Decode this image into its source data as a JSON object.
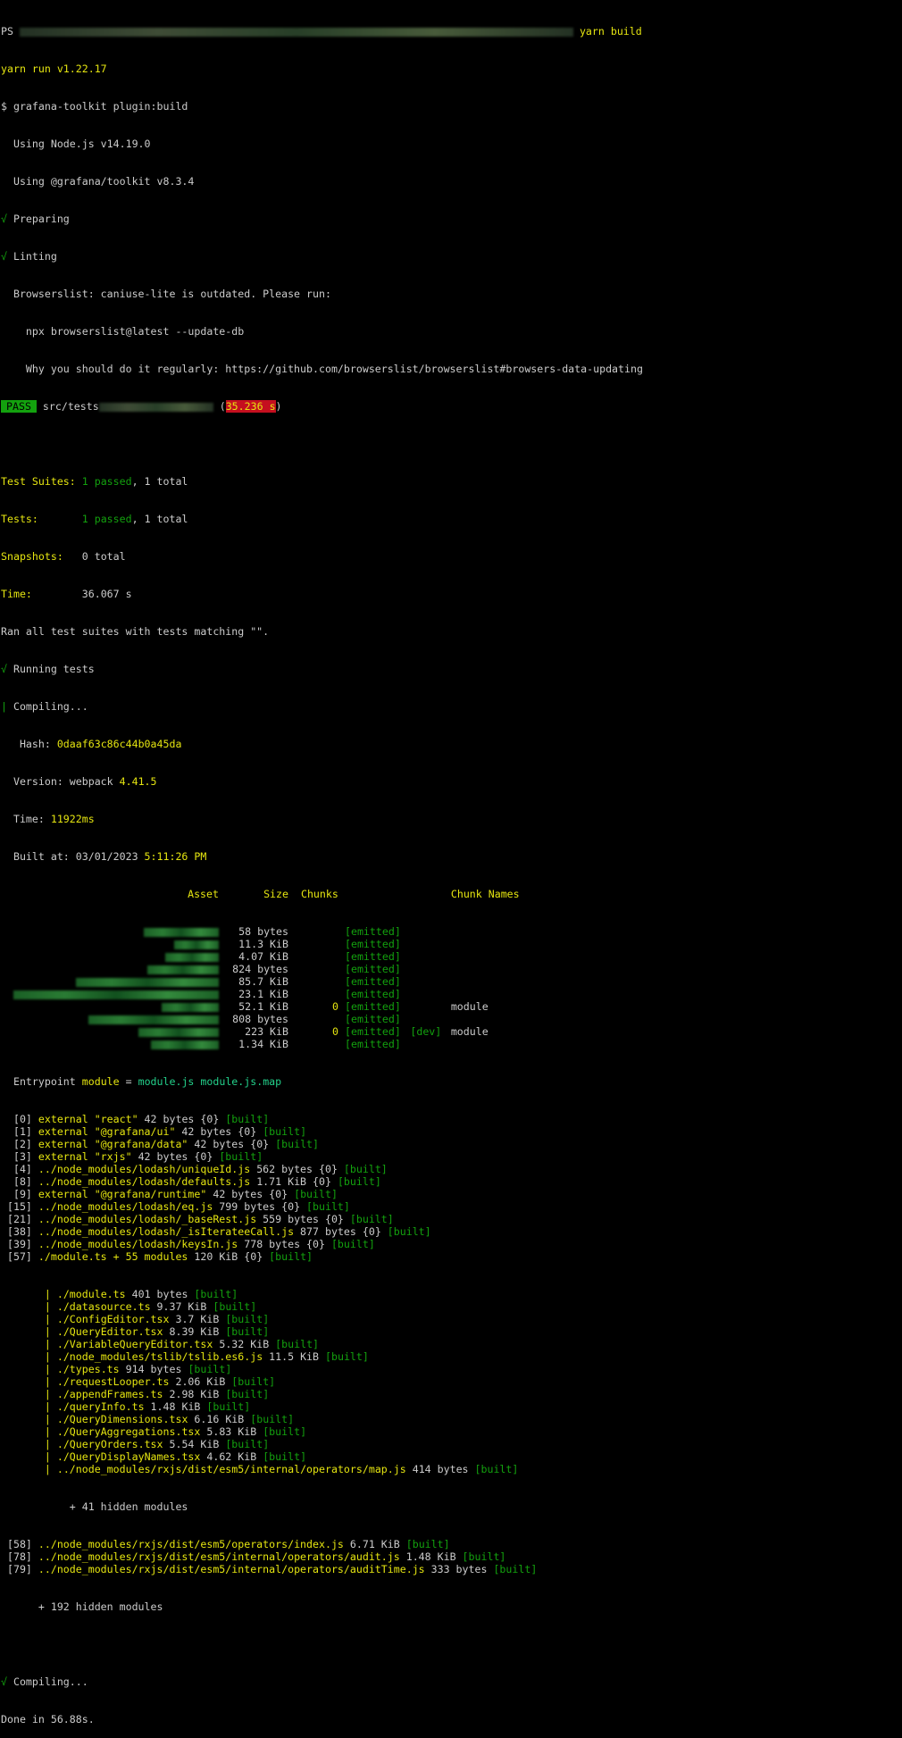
{
  "prompt": {
    "ps": "PS",
    "cmd": "yarn build"
  },
  "lines": {
    "yarn_run": "yarn run v1.22.17",
    "cmd": "$ grafana-toolkit plugin:build",
    "node": "  Using Node.js v14.19.0",
    "toolkit": "  Using @grafana/toolkit v8.3.4",
    "preparing": "Preparing",
    "linting": "Linting",
    "browserslist1": "  Browserslist: caniuse-lite is outdated. Please run:",
    "browserslist2": "    npx browserslist@latest --update-db",
    "browserslist3": "    Why you should do it regularly: https://github.com/browserslist/browserslist#browsers-data-updating",
    "pass": "PASS",
    "pass_path": " src/tests",
    "pass_time": "35.236 s",
    "suites_label": "Test Suites:",
    "suites_passed": "1 passed",
    "suites_total": ", 1 total",
    "tests_label": "Tests:",
    "tests_passed": "1 passed",
    "tests_total": ", 1 total",
    "snap_label": "Snapshots:",
    "snap_val": "0 total",
    "time_label": "Time:",
    "time_val": "36.067 s",
    "ran": "Ran all test suites with tests matching \"\".",
    "running": "Running tests",
    "compiling": "Compiling...",
    "hash_label": "   Hash: ",
    "hash_val": "0daaf63c86c44b0a45da",
    "version_label": "  Version: webpack ",
    "version_val": "4.41.5",
    "time2_label": "  Time: ",
    "time2_val": "11922ms",
    "built_label": "  Built at: 03/01/2023 ",
    "built_val": "5:11:26 PM",
    "entry_a": "  Entrypoint ",
    "entry_b": "module",
    "entry_c": " = ",
    "entry_d": "module.js module.js.map",
    "hidden41": "           + 41 hidden modules",
    "hidden192": "      + 192 hidden modules",
    "compiling2": "Compiling...",
    "done": "Done in 56.88s."
  },
  "asset_table": {
    "headers": {
      "asset": "Asset",
      "size": "Size",
      "chunks": "Chunks",
      "names": "Chunk Names"
    },
    "rows": [
      {
        "size": "58 bytes",
        "chunk": "",
        "status": "[emitted]",
        "dev": "",
        "name": ""
      },
      {
        "size": "11.3 KiB",
        "chunk": "",
        "status": "[emitted]",
        "dev": "",
        "name": ""
      },
      {
        "size": "4.07 KiB",
        "chunk": "",
        "status": "[emitted]",
        "dev": "",
        "name": ""
      },
      {
        "size": "824 bytes",
        "chunk": "",
        "status": "[emitted]",
        "dev": "",
        "name": ""
      },
      {
        "size": "85.7 KiB",
        "chunk": "",
        "status": "[emitted]",
        "dev": "",
        "name": ""
      },
      {
        "size": "23.1 KiB",
        "chunk": "",
        "status": "[emitted]",
        "dev": "",
        "name": ""
      },
      {
        "size": "52.1 KiB",
        "chunk": "0",
        "status": "[emitted]",
        "dev": "",
        "name": "module"
      },
      {
        "size": "808 bytes",
        "chunk": "",
        "status": "[emitted]",
        "dev": "",
        "name": ""
      },
      {
        "size": "223 KiB",
        "chunk": "0",
        "status": "[emitted]",
        "dev": "[dev]",
        "name": "module"
      },
      {
        "size": "1.34 KiB",
        "chunk": "",
        "status": "[emitted]",
        "dev": "",
        "name": ""
      }
    ]
  },
  "modules": [
    {
      "id": "  [0]",
      "path": " external \"react\"",
      "size": " 42 bytes {0} ",
      "built": "[built]"
    },
    {
      "id": "  [1]",
      "path": " external \"@grafana/ui\"",
      "size": " 42 bytes {0} ",
      "built": "[built]"
    },
    {
      "id": "  [2]",
      "path": " external \"@grafana/data\"",
      "size": " 42 bytes {0} ",
      "built": "[built]"
    },
    {
      "id": "  [3]",
      "path": " external \"rxjs\"",
      "size": " 42 bytes {0} ",
      "built": "[built]"
    },
    {
      "id": "  [4]",
      "path": " ../node_modules/lodash/uniqueId.js",
      "size": " 562 bytes {0} ",
      "built": "[built]"
    },
    {
      "id": "  [8]",
      "path": " ../node_modules/lodash/defaults.js",
      "size": " 1.71 KiB {0} ",
      "built": "[built]"
    },
    {
      "id": "  [9]",
      "path": " external \"@grafana/runtime\"",
      "size": " 42 bytes {0} ",
      "built": "[built]"
    },
    {
      "id": " [15]",
      "path": " ../node_modules/lodash/eq.js",
      "size": " 799 bytes {0} ",
      "built": "[built]"
    },
    {
      "id": " [21]",
      "path": " ../node_modules/lodash/_baseRest.js",
      "size": " 559 bytes {0} ",
      "built": "[built]"
    },
    {
      "id": " [38]",
      "path": " ../node_modules/lodash/_isIterateeCall.js",
      "size": " 877 bytes {0} ",
      "built": "[built]"
    },
    {
      "id": " [39]",
      "path": " ../node_modules/lodash/keysIn.js",
      "size": " 778 bytes {0} ",
      "built": "[built]"
    },
    {
      "id": " [57]",
      "path": " ./module.ts + 55 modules",
      "size": " 120 KiB {0} ",
      "built": "[built]"
    }
  ],
  "submodules": [
    {
      "path": "./module.ts",
      "size": " 401 bytes ",
      "built": "[built]"
    },
    {
      "path": "./datasource.ts",
      "size": " 9.37 KiB ",
      "built": "[built]"
    },
    {
      "path": "./ConfigEditor.tsx",
      "size": " 3.7 KiB ",
      "built": "[built]"
    },
    {
      "path": "./QueryEditor.tsx",
      "size": " 8.39 KiB ",
      "built": "[built]"
    },
    {
      "path": "./VariableQueryEditor.tsx",
      "size": " 5.32 KiB ",
      "built": "[built]"
    },
    {
      "path": "./node_modules/tslib/tslib.es6.js",
      "size": " 11.5 KiB ",
      "built": "[built]"
    },
    {
      "path": "./types.ts",
      "size": " 914 bytes ",
      "built": "[built]"
    },
    {
      "path": "./requestLooper.ts",
      "size": " 2.06 KiB ",
      "built": "[built]"
    },
    {
      "path": "./appendFrames.ts",
      "size": " 2.98 KiB ",
      "built": "[built]"
    },
    {
      "path": "./queryInfo.ts",
      "size": " 1.48 KiB ",
      "built": "[built]"
    },
    {
      "path": "./QueryDimensions.tsx",
      "size": " 6.16 KiB ",
      "built": "[built]"
    },
    {
      "path": "./QueryAggregations.tsx",
      "size": " 5.83 KiB ",
      "built": "[built]"
    },
    {
      "path": "./QueryOrders.tsx",
      "size": " 5.54 KiB ",
      "built": "[built]"
    },
    {
      "path": "./QueryDisplayNames.tsx",
      "size": " 4.62 KiB ",
      "built": "[built]"
    },
    {
      "path": "../node_modules/rxjs/dist/esm5/internal/operators/map.js",
      "size": " 414 bytes ",
      "built": "[built]"
    }
  ],
  "modules2": [
    {
      "id": " [58]",
      "path": " ../node_modules/rxjs/dist/esm5/operators/index.js",
      "size": " 6.71 KiB ",
      "built": "[built]"
    },
    {
      "id": " [78]",
      "path": " ../node_modules/rxjs/dist/esm5/internal/operators/audit.js",
      "size": " 1.48 KiB ",
      "built": "[built]"
    },
    {
      "id": " [79]",
      "path": " ../node_modules/rxjs/dist/esm5/internal/operators/auditTime.js",
      "size": " 333 bytes ",
      "built": "[built]"
    }
  ],
  "colors": {
    "bg": "#000000",
    "fg": "#cccccc",
    "yellow": "#e5e510",
    "green": "#13a10e"
  }
}
